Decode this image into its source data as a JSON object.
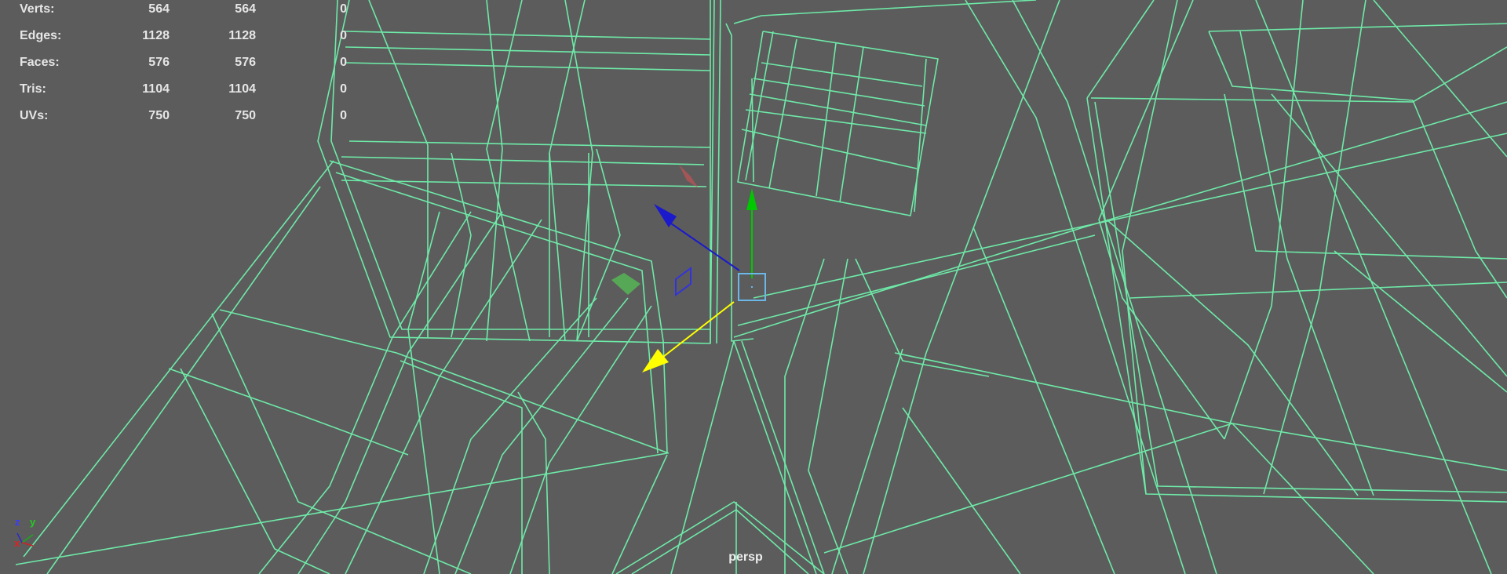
{
  "hud": {
    "rows": [
      {
        "label": "Verts:",
        "total": "564",
        "selected": "564",
        "extra": "0"
      },
      {
        "label": "Edges:",
        "total": "1128",
        "selected": "1128",
        "extra": "0"
      },
      {
        "label": "Faces:",
        "total": "576",
        "selected": "576",
        "extra": "0"
      },
      {
        "label": "Tris:",
        "total": "1104",
        "selected": "1104",
        "extra": "0"
      },
      {
        "label": "UVs:",
        "total": "750",
        "selected": "750",
        "extra": "0"
      }
    ]
  },
  "viewport": {
    "camera": "persp",
    "background": "#5c5c5c",
    "wire_color": "#6eeaa8"
  },
  "axis_indicator": {
    "x": "x",
    "y": "y",
    "z": "z"
  },
  "manipulator": {
    "x_axis_color": "#ffff00",
    "y_axis_color": "#00c800",
    "z_axis_color": "#0000c8",
    "center_box_color": "#6ab7e8"
  }
}
